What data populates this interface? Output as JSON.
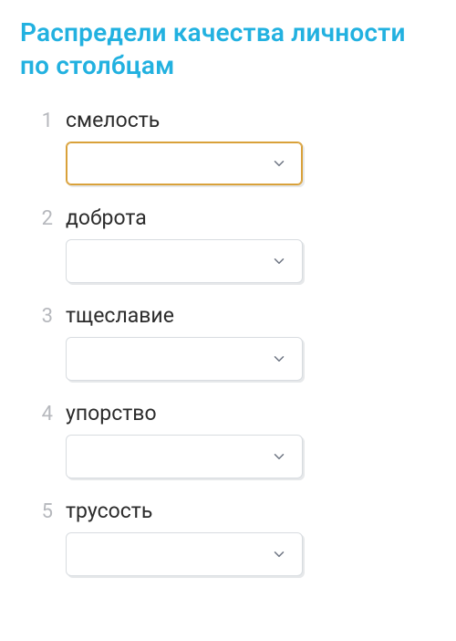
{
  "title": "Распредели качества личности по столбцам",
  "items": [
    {
      "num": "1",
      "label": "смелость",
      "active": true
    },
    {
      "num": "2",
      "label": "доброта",
      "active": false
    },
    {
      "num": "3",
      "label": "тщеславие",
      "active": false
    },
    {
      "num": "4",
      "label": "упорство",
      "active": false
    },
    {
      "num": "5",
      "label": "трусость",
      "active": false
    }
  ],
  "colors": {
    "accent": "#22b1e0",
    "focus_border": "#d9a13a",
    "chevron": "#6d7482"
  }
}
